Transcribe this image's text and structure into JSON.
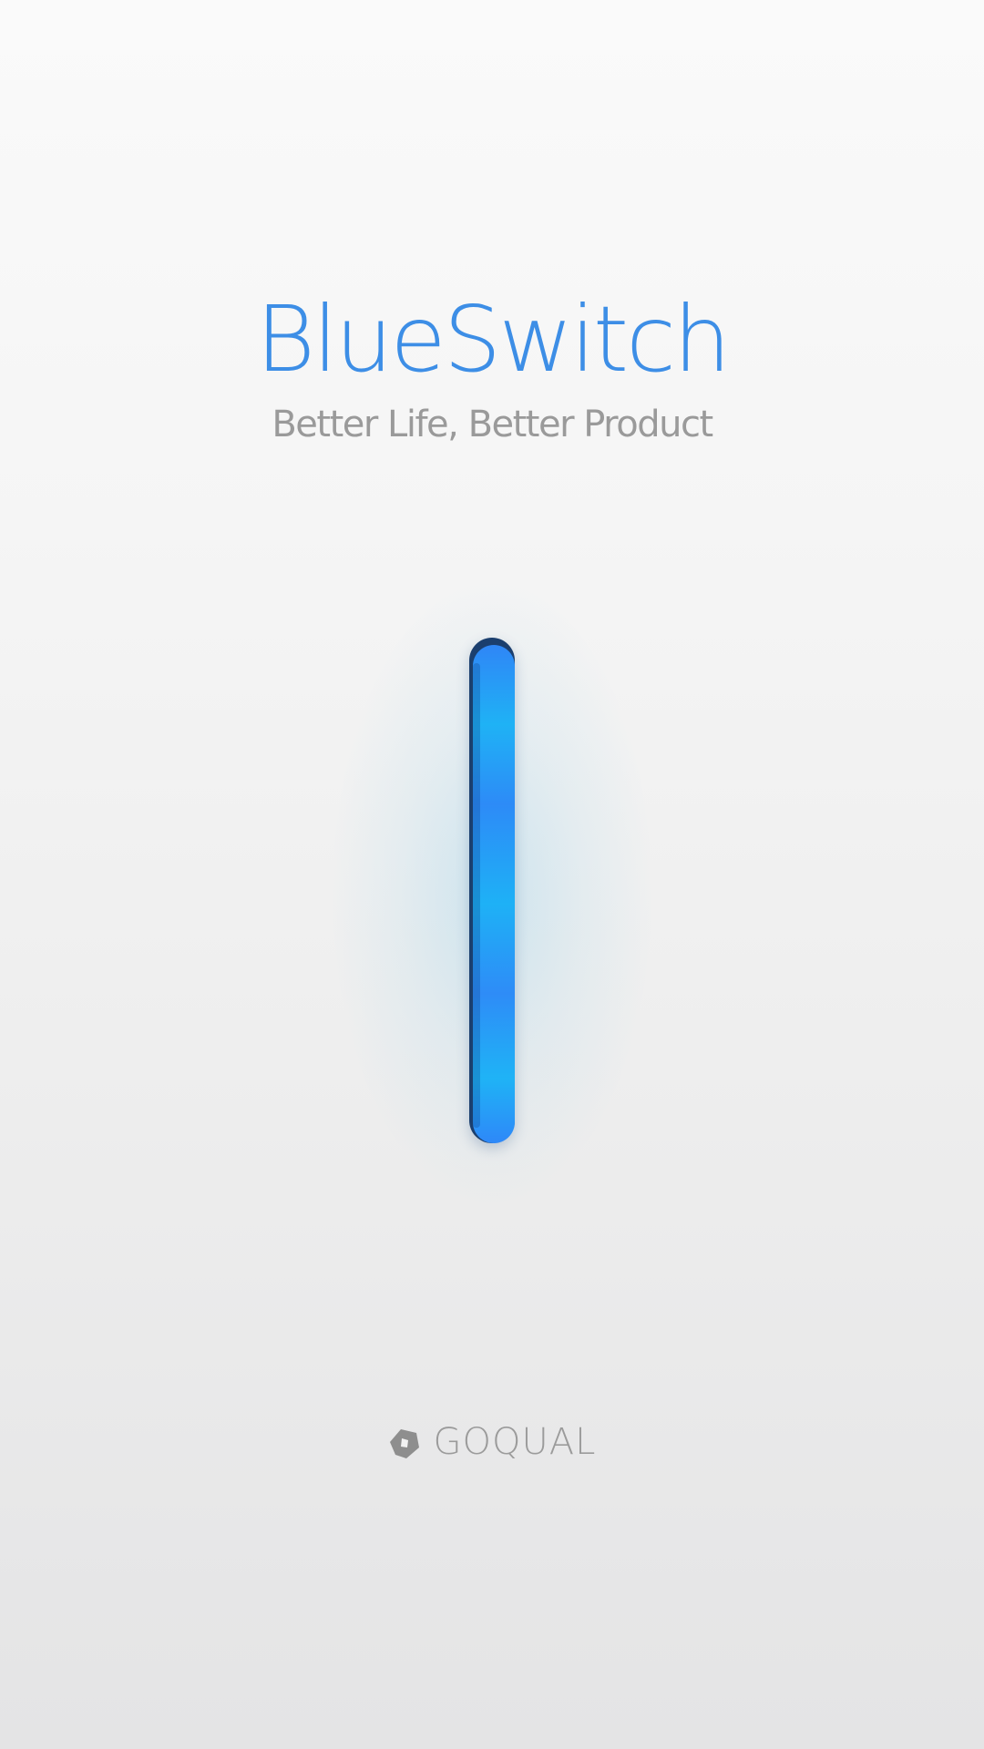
{
  "splash": {
    "title": "BlueSwitch",
    "tagline": "Better Life, Better Product",
    "switch_state": "on",
    "brand": {
      "icon": "goqual-logo-icon",
      "name": "GOQUAL"
    }
  },
  "colors": {
    "title": "#3d8ee6",
    "tagline": "#9a9a9a",
    "switch_blue": "#2e8cf7",
    "switch_cyan": "#1fb2f5",
    "brand_gray": "#9b9b9b"
  }
}
